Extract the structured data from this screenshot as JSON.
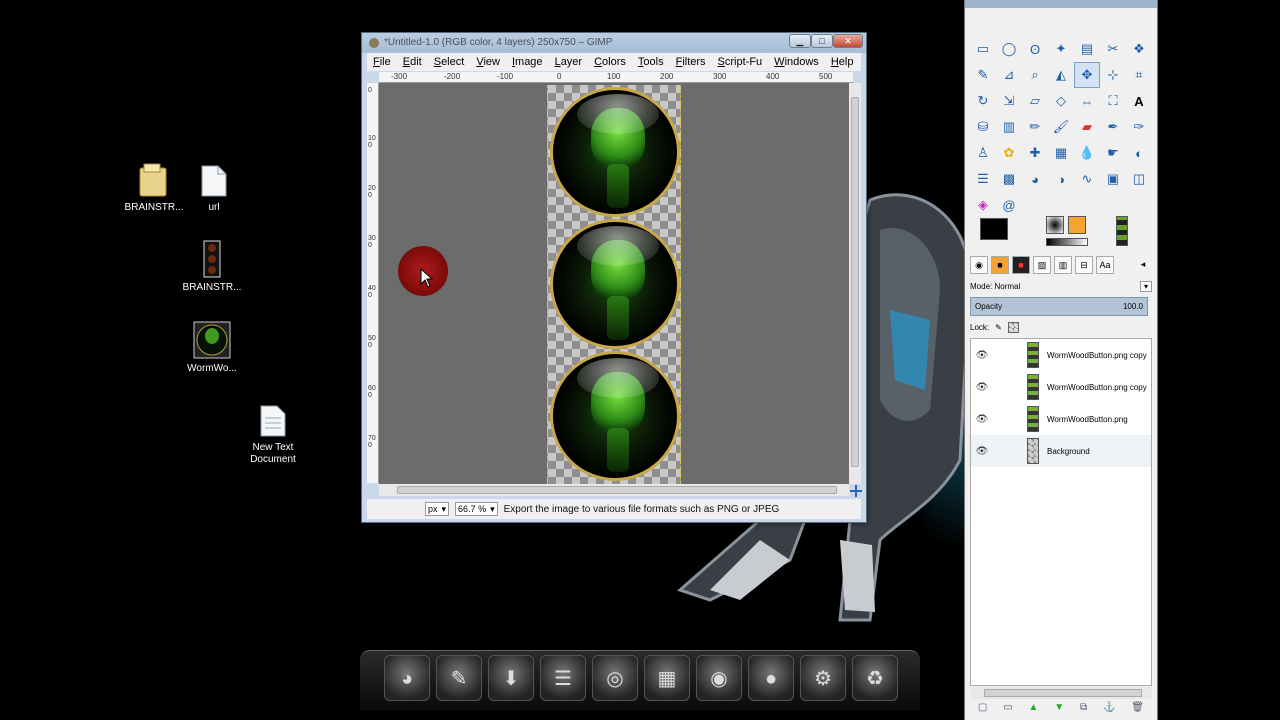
{
  "desktop": {
    "icons": [
      {
        "label": "BRAINSTR...",
        "icon": "folder-icon"
      },
      {
        "label": "url",
        "icon": "file-icon"
      },
      {
        "label": "BRAINSTR...",
        "icon": "strip-image-icon"
      },
      {
        "label": "WormWo...",
        "icon": "image-file-icon"
      },
      {
        "label": "New Text Document",
        "icon": "text-document-icon"
      }
    ]
  },
  "image_window": {
    "title": "*Untitled-1.0 (RGB color, 4 layers) 250x750 – GIMP",
    "menu": [
      "File",
      "Edit",
      "Select",
      "View",
      "Image",
      "Layer",
      "Colors",
      "Tools",
      "Filters",
      "Script-Fu",
      "Windows",
      "Help"
    ],
    "ruler_top_labels": [
      "-300",
      "-200",
      "-100",
      "0",
      "100",
      "200",
      "300",
      "400",
      "500"
    ],
    "ruler_left_labels": [
      "0",
      "100",
      "200",
      "300",
      "400",
      "500",
      "600",
      "700"
    ],
    "unit": "px",
    "zoom": "66.7 %",
    "status_message": "Export the image to various file formats such as PNG or JPEG",
    "orb_count": 3
  },
  "dock": {
    "mode_label": "Mode:",
    "mode_value": "Normal",
    "opacity_label": "Opacity",
    "opacity_value": "100.0",
    "lock_label": "Lock:",
    "layers": [
      {
        "name": "WormWoodButton.png copy",
        "visible": true
      },
      {
        "name": "WormWoodButton.png copy",
        "visible": true
      },
      {
        "name": "WormWoodButton.png",
        "visible": true
      },
      {
        "name": "Background",
        "visible": true
      }
    ]
  },
  "colors": {
    "foreground": "#000000",
    "background": "#ffffff",
    "accent_orange": "#f7a234",
    "selection_blue": "#b3c4d6"
  }
}
